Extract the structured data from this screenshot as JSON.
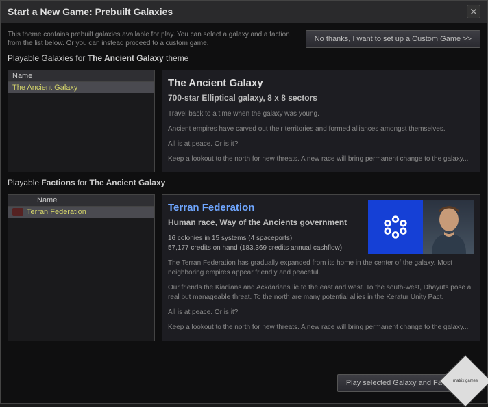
{
  "window": {
    "title": "Start a New Game: Prebuilt Galaxies"
  },
  "intro": "This theme contains prebuilt galaxies available for play. You can select a galaxy and a faction from the list below. Or you can instead proceed to a custom game.",
  "buttons": {
    "custom_game": "No thanks, I want to set up a Custom Game >>",
    "play_selected": "Play selected Galaxy and Faction >>"
  },
  "galaxies": {
    "section_label_prefix": "Playable Galaxies for ",
    "section_label_theme": "The Ancient Galaxy",
    "section_label_suffix": " theme",
    "header": "Name",
    "items": [
      {
        "name": "The Ancient Galaxy"
      }
    ],
    "detail": {
      "title": "The Ancient Galaxy",
      "subtitle": "700-star Elliptical galaxy, 8 x 8 sectors",
      "paras": [
        "Travel back to a time when the galaxy was young.",
        "Ancient empires have carved out their territories and formed alliances amongst themselves.",
        "All is at peace. Or is it?",
        "Keep a lookout to the north for new threats. A new race will bring permanent change to the galaxy..."
      ]
    }
  },
  "factions": {
    "section_label_prefix": "Playable ",
    "section_label_em": "Factions",
    "section_label_suffix": " for ",
    "section_label_theme": "The Ancient Galaxy",
    "header_icon": "",
    "header_name": "Name",
    "items": [
      {
        "name": "Terran Federation"
      }
    ],
    "detail": {
      "title": "Terran Federation",
      "subtitle": "Human race, Way of the Ancients government",
      "stat1": "16 colonies in 15 systems (4 spaceports)",
      "stat2": "57,177 credits on hand (183,369 credits annual cashflow)",
      "paras": [
        "The Terran Federation has gradually expanded from its home in the center of the galaxy. Most neighboring empires appear friendly and peaceful.",
        "Our friends the Kiadians and Ackdarians lie to the east and west. To the south-west, Dhayuts pose a real but manageable threat. To the north are many potential allies in the Keratur Unity Pact.",
        "All is at peace. Or is it?",
        "Keep a lookout to the north for new threats. A new race will bring permanent change to the galaxy..."
      ]
    }
  },
  "corner_logo": "matrix games",
  "colors": {
    "accent_blue": "#6fa6ff"
  }
}
